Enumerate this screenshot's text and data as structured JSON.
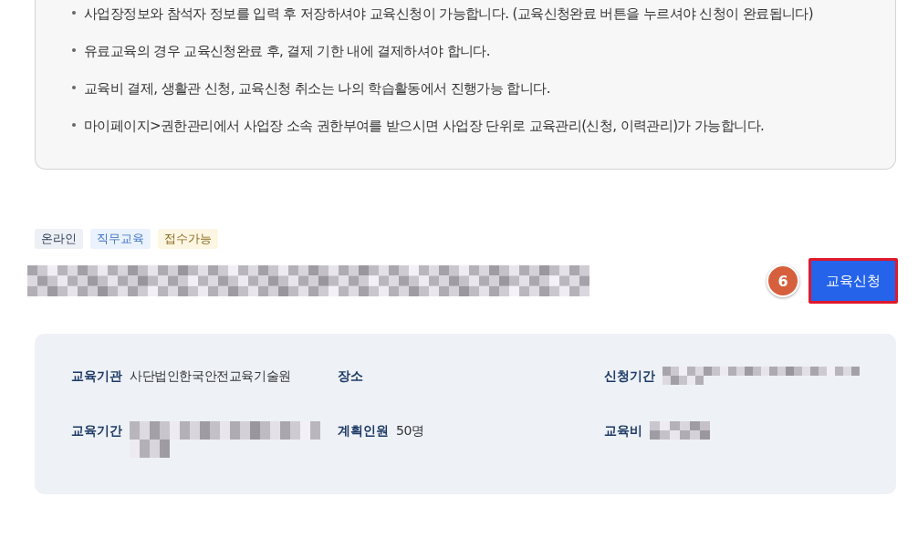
{
  "notice": {
    "items": [
      "사업장정보와 참석자 정보를 입력 후 저장하셔야 교육신청이 가능합니다. (교육신청완료 버튼을 누르셔야 신청이 완료됩니다)",
      "유료교육의 경우 교육신청완료 후, 결제 기한 내에 결제하셔야 합니다.",
      "교육비 결제, 생활관 신청, 교육신청 취소는 나의 학습활동에서 진행가능 합니다.",
      "마이페이지>권한관리에서 사업장 소속 권한부여를 받으시면 사업장 단위로 교육관리(신청, 이력관리)가 가능합니다."
    ]
  },
  "tags": [
    {
      "label": "온라인",
      "kind": "mode"
    },
    {
      "label": "직무교육",
      "kind": "category"
    },
    {
      "label": "접수가능",
      "kind": "status"
    }
  ],
  "apply_button": {
    "label": "교육신청",
    "highlighted": true,
    "step": "6"
  },
  "info": [
    {
      "label": "교육기관",
      "kind": "text",
      "value": "사단법인한국안전교육기술원"
    },
    {
      "label": "장소",
      "kind": "empty"
    },
    {
      "label": "신청기간",
      "kind": "redacted"
    },
    {
      "label": "교육기간",
      "kind": "redacted"
    },
    {
      "label": "계획인원",
      "kind": "text",
      "value": "50명"
    },
    {
      "label": "교육비",
      "kind": "redacted"
    }
  ]
}
